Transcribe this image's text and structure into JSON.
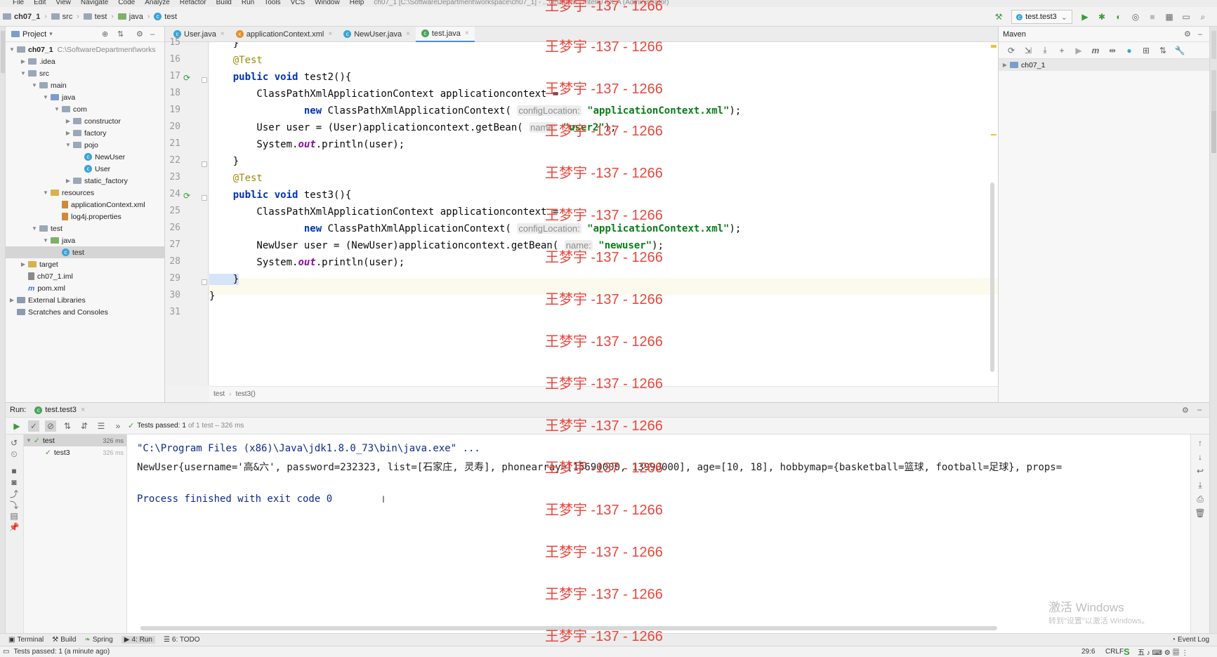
{
  "menu": [
    "File",
    "Edit",
    "View",
    "Navigate",
    "Code",
    "Analyze",
    "Refactor",
    "Build",
    "Run",
    "Tools",
    "VCS",
    "Window",
    "Help",
    "ch07_1 [C:\\SoftwareDepartment\\workspace\\ch07_1] - ...\\test.java - IntelliJ IDEA (Administrator)"
  ],
  "breadcrumb": [
    "ch07_1",
    "src",
    "test",
    "java",
    "test"
  ],
  "run_config": "test.test3",
  "project_panel": {
    "title": "Project",
    "tree": [
      {
        "label": "ch07_1",
        "path": "C:\\SoftwareDepartment\\works",
        "depth": 0,
        "kind": "module"
      },
      {
        "label": ".idea",
        "depth": 1,
        "kind": "folder"
      },
      {
        "label": "src",
        "depth": 1,
        "kind": "folder"
      },
      {
        "label": "main",
        "depth": 2,
        "kind": "folder"
      },
      {
        "label": "java",
        "depth": 3,
        "kind": "blue"
      },
      {
        "label": "com",
        "depth": 4,
        "kind": "folder"
      },
      {
        "label": "constructor",
        "depth": 5,
        "kind": "folder"
      },
      {
        "label": "factory",
        "depth": 5,
        "kind": "folder"
      },
      {
        "label": "pojo",
        "depth": 5,
        "kind": "folder"
      },
      {
        "label": "NewUser",
        "depth": 6,
        "kind": "class"
      },
      {
        "label": "User",
        "depth": 6,
        "kind": "class"
      },
      {
        "label": "static_factory",
        "depth": 5,
        "kind": "folder"
      },
      {
        "label": "resources",
        "depth": 3,
        "kind": "yellow"
      },
      {
        "label": "applicationContext.xml",
        "depth": 4,
        "kind": "xml"
      },
      {
        "label": "log4j.properties",
        "depth": 4,
        "kind": "xml"
      },
      {
        "label": "test",
        "depth": 2,
        "kind": "folder"
      },
      {
        "label": "java",
        "depth": 3,
        "kind": "green"
      },
      {
        "label": "test",
        "depth": 4,
        "kind": "class",
        "selected": true
      },
      {
        "label": "target",
        "depth": 1,
        "kind": "yellow"
      },
      {
        "label": "ch07_1.iml",
        "depth": 1,
        "kind": "file"
      },
      {
        "label": "pom.xml",
        "depth": 1,
        "kind": "maven"
      },
      {
        "label": "External Libraries",
        "depth": 0,
        "kind": "lib"
      },
      {
        "label": "Scratches and Consoles",
        "depth": 0,
        "kind": "lib"
      }
    ]
  },
  "tabs": [
    {
      "label": "User.java",
      "active": false
    },
    {
      "label": "applicationContext.xml",
      "active": false
    },
    {
      "label": "NewUser.java",
      "active": false
    },
    {
      "label": "test.java",
      "active": true
    }
  ],
  "editor": {
    "line_numbers": [
      "15",
      "16",
      "17",
      "18",
      "19",
      "20",
      "21",
      "22",
      "23",
      "24",
      "25",
      "26",
      "27",
      "28",
      "29",
      "30",
      "31"
    ],
    "code_segments": {
      "l15": "    }",
      "l16": "    @Test",
      "l17a": "    public void",
      "l17b": " test2(){",
      "l18": "        ClassPathXmlApplicationContext applicationcontext =",
      "l19a": "                new",
      "l19b": " ClassPathXmlApplicationContext( ",
      "l19hint": "configLocation:",
      "l19str": " \"applicationContext.xml\"",
      "l19end": ");",
      "l20a": "        User user = (User)applicationcontext.getBean( ",
      "l20hint": "name:",
      "l20str": " \"user2\"",
      "l20end": ");",
      "l21a": "        System.",
      "l21out": "out",
      "l21b": ".println(user);",
      "l22": "    }",
      "l23": "    @Test",
      "l24a": "    public void",
      "l24b": " test3(){",
      "l25": "        ClassPathXmlApplicationContext applicationcontext =",
      "l26a": "                new",
      "l26b": " ClassPathXmlApplicationContext( ",
      "l26hint": "configLocation:",
      "l26str": " \"applicationContext.xml\"",
      "l26end": ");",
      "l27a": "        NewUser user = (NewUser)applicationcontext.getBean( ",
      "l27hint": "name:",
      "l27str": " \"newuser\"",
      "l27end": ");",
      "l28a": "        System.",
      "l28out": "out",
      "l28b": ".println(user);",
      "l29": "    }",
      "l30": "}"
    },
    "crumbs": [
      "test",
      "test3()"
    ]
  },
  "maven": {
    "title": "Maven",
    "root": "ch07_1"
  },
  "run": {
    "label": "Run:",
    "tab": "test.test3",
    "status_prefix": "Tests passed:",
    "status_count": "1",
    "status_suffix": "of 1 test – 326 ms",
    "tree": [
      {
        "label": "test",
        "time": "326 ms"
      },
      {
        "label": "test3",
        "time": "326 ms"
      }
    ],
    "console": [
      "\"C:\\Program Files (x86)\\Java\\jdk1.8.0_73\\bin\\java.exe\" ...",
      "NewUser{username='高&六', password=232323, list=[石家庄, 灵寿], phonearray=[15690000, 13990000], age=[10, 18], hobbymap={basketball=篮球, football=足球}, props=",
      "",
      "Process finished with exit code 0"
    ]
  },
  "bottom_tabs": [
    "Terminal",
    "Build",
    "Spring",
    "4: Run",
    "6: TODO"
  ],
  "event_log": "Event Log",
  "status": {
    "message": "Tests passed: 1 (a minute ago)",
    "position": "29:6",
    "line_sep": "CRLF"
  },
  "watermark": "王梦宇 -137 - 1266",
  "windows_activation": [
    "激活 Windows",
    "转到\"设置\"以激活 Windows。"
  ],
  "colors": {
    "keyword": "#0033b3",
    "string": "#067d17",
    "annotation": "#9e880d",
    "watermark": "#e8473e",
    "accent": "#4a8de0"
  }
}
